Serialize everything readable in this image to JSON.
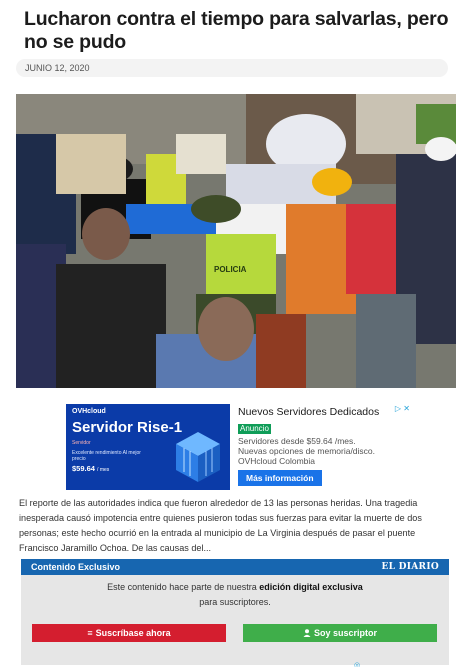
{
  "article": {
    "title": "Lucharon contra el tiempo para salvarlas, pero no se pudo",
    "date": "JUNIO 12, 2020",
    "body": "El reporte de las autoridades indica que fueron alrededor de 13 las personas heridas. Una tragedia inesperada causó impotencia entre quienes pusieron todas sus fuerzas para evitar la muerte de dos personas; este hecho ocurrió en la entrada al municipio de La Virginia después de pasar el puente Francisco Jaramillo Ochoa. De las causas del..."
  },
  "photo": {
    "vest_text": "POLICIA"
  },
  "ad": {
    "brand": "OVHcloud",
    "banner_title": "Servidor Rise-1",
    "banner_tag": "Servidor",
    "banner_small": "Excelente rendimiento Al mejor precio",
    "banner_price": "$59.64",
    "banner_price_unit": "/ mes",
    "title": "Nuevos Servidores Dedicados",
    "badge": "Anuncio",
    "line1": "Servidores desde $59.64 /mes.",
    "line2": "Nuevas opciones de memoria/disco.",
    "line3": "OVHcloud Colombia",
    "cta": "Más información",
    "adchoices": "▷ ✕"
  },
  "exclusive": {
    "label": "Contenido Exclusivo",
    "logo": "EL DIARIO",
    "msg_prefix": "Este contenido hace parte de nuestra",
    "msg_bold": "edición digital exclusiva",
    "msg_suffix": "para suscriptores.",
    "subscribe_label": "Suscríbase ahora",
    "subscriber_label": "Soy suscriptor"
  },
  "colors": {
    "accent_blue": "#1766b0",
    "subscribe_red": "#d41e2f",
    "subscriber_green": "#3fae4a"
  }
}
